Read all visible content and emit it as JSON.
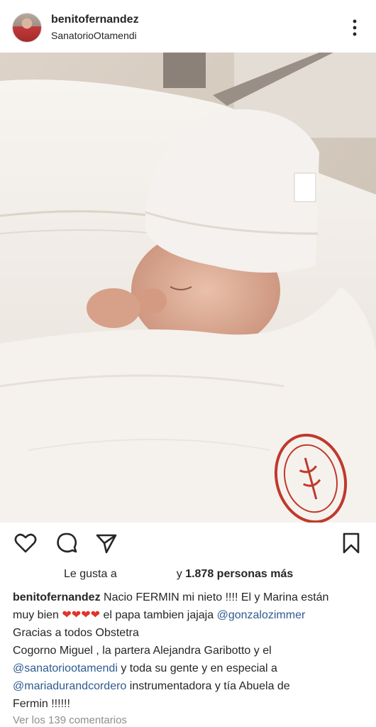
{
  "header": {
    "username": "benitofernandez",
    "location": "SanatorioOtamendi"
  },
  "icons": {
    "more": "more-vertical-icon",
    "like": "heart-outline-icon",
    "comment": "comment-bubble-icon",
    "share": "send-arrow-icon",
    "save": "bookmark-icon"
  },
  "likes": {
    "prefix": "Le gusta a",
    "suffix_and": "y",
    "count_text": "1.878 personas más"
  },
  "caption": {
    "username": "benitofernandez",
    "line1": "Nacio FERMIN mi nieto !!!! El y Marina están",
    "line2a": "muy bien",
    "hearts": "❤❤❤❤",
    "line2b": "el papa tambien jajaja",
    "mention1": "@gonzalozimmer",
    "line3": "Gracias a todos  Obstetra",
    "line4": "Cogorno Miguel , la partera Alejandra Garibotto y el",
    "mention2": "@sanatoriootamendi",
    "line5": "y toda su gente y en especial a",
    "mention3": "@mariadurandcordero",
    "line6": "instrumentadora y tía Abuela de",
    "line7": "Fermin !!!!!!"
  },
  "comments": {
    "label": "Ver los 139 comentarios"
  },
  "colors": {
    "text": "#262626",
    "mention": "#2f5b8f",
    "muted": "#8e8e8e",
    "heart": "#e0352b",
    "stamp": "#c0392b"
  }
}
